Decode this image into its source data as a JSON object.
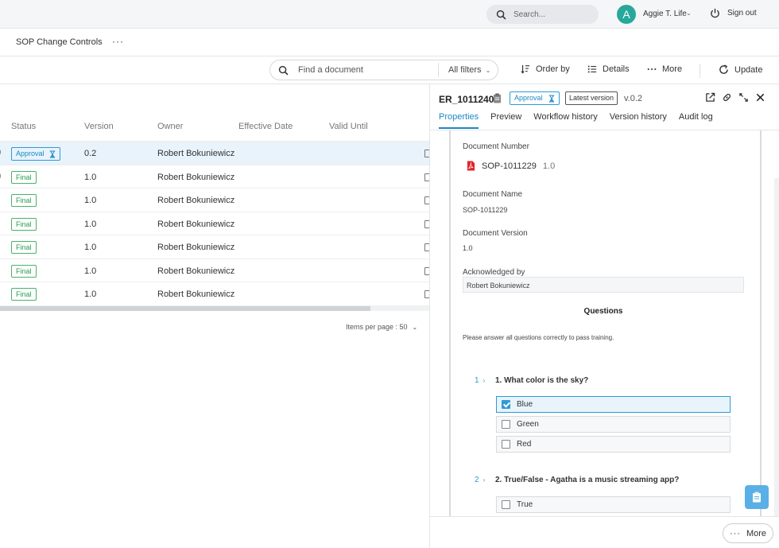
{
  "topbar": {
    "search_placeholder": "Search...",
    "avatar_initial": "A",
    "user_name": "Aggie T. Life",
    "signout_label": "Sign out"
  },
  "crumbbar": {
    "title": "SOP Change Controls",
    "more": "···"
  },
  "toolbar": {
    "find_placeholder": "Find a document",
    "filters_label": "All filters",
    "order_label": "Order by",
    "details_label": "Details",
    "more_label": "More",
    "update_label": "Update"
  },
  "table": {
    "headers": [
      "Status",
      "Version",
      "Owner",
      "Effective Date",
      "Valid Until"
    ],
    "rows": [
      {
        "status": "Approval",
        "version": "0.2",
        "owner": "Robert Bokuniewicz"
      },
      {
        "status": "Final",
        "version": "1.0",
        "owner": "Robert Bokuniewicz"
      },
      {
        "status": "Final",
        "version": "1.0",
        "owner": "Robert Bokuniewicz"
      },
      {
        "status": "Final",
        "version": "1.0",
        "owner": "Robert Bokuniewicz"
      },
      {
        "status": "Final",
        "version": "1.0",
        "owner": "Robert Bokuniewicz"
      },
      {
        "status": "Final",
        "version": "1.0",
        "owner": "Robert Bokuniewicz"
      },
      {
        "status": "Final",
        "version": "1.0",
        "owner": "Robert Bokuniewicz"
      }
    ],
    "pager": "Items per page : 50"
  },
  "panel": {
    "doc_id": "ER_1011240",
    "status_badge": "Approval",
    "latest_badge": "Latest version",
    "version": "v.0.2",
    "tabs": [
      "Properties",
      "Preview",
      "Workflow history",
      "Version history",
      "Audit log"
    ],
    "doc_number_label": "Document Number",
    "doc_number": "SOP-1011229",
    "doc_number_version": "1.0",
    "doc_name_label": "Document Name",
    "doc_name": "SOP-1011229",
    "doc_version_label": "Document Version",
    "doc_version": "1.0",
    "ack_label": "Acknowledged by",
    "ack_value": "Robert Bokuniewicz",
    "questions_heading": "Questions",
    "questions_instruction": "Please answer all questions correctly to pass training.",
    "questions": [
      {
        "num": "1",
        "text": "1.  What color is the sky?",
        "options": [
          "Blue",
          "Green",
          "Red"
        ]
      },
      {
        "num": "2",
        "text": "2.  True/False - Agatha is a music streaming app?",
        "options": [
          "True"
        ]
      }
    ],
    "footer_more": "More"
  },
  "colors": {
    "accent": "#1c88c4",
    "final_green": "#2a9a50",
    "avatar": "#28a89a",
    "pdf_red": "#e0262a"
  }
}
